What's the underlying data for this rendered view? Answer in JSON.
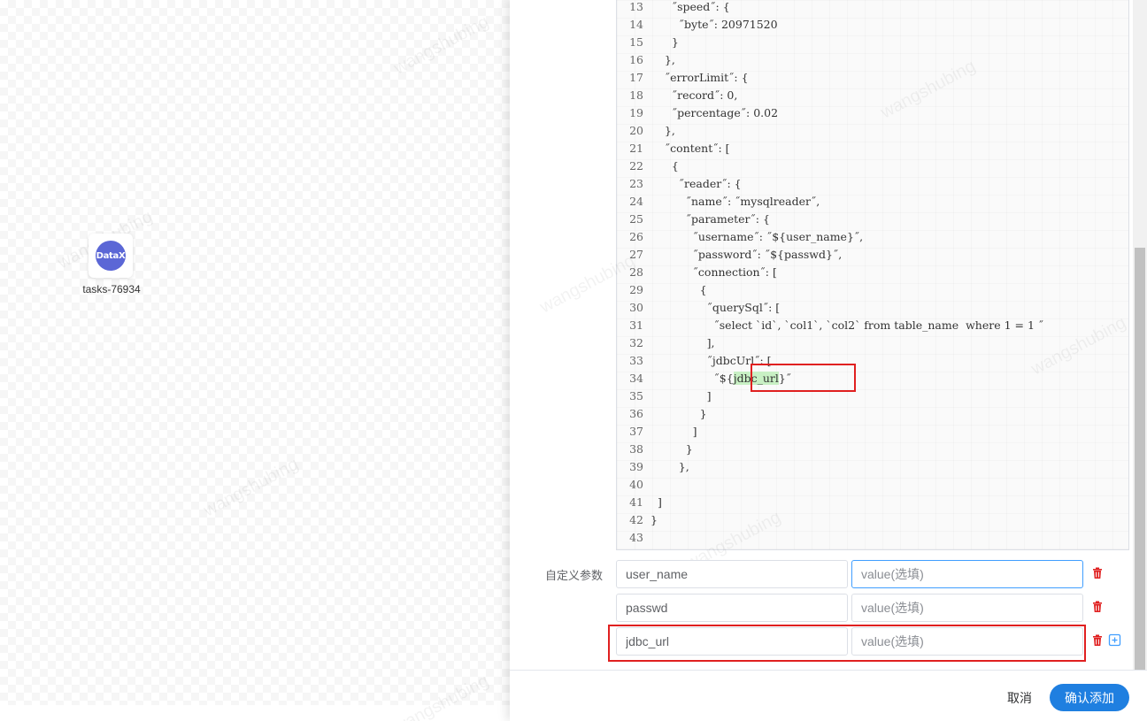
{
  "canvas": {
    "node": {
      "logo_text": "DataX",
      "label": "tasks-76934"
    },
    "watermark_text": "wangshubing"
  },
  "editor": {
    "lines": [
      {
        "num": "13",
        "text": "      ˝speed˝: {"
      },
      {
        "num": "14",
        "text": "        ˝byte˝: 20971520"
      },
      {
        "num": "15",
        "text": "      }"
      },
      {
        "num": "16",
        "text": "    },"
      },
      {
        "num": "17",
        "text": "    ˝errorLimit˝: {"
      },
      {
        "num": "18",
        "text": "      ˝record˝: 0,"
      },
      {
        "num": "19",
        "text": "      ˝percentage˝: 0.02"
      },
      {
        "num": "20",
        "text": "    },"
      },
      {
        "num": "21",
        "text": "    ˝content˝: ["
      },
      {
        "num": "22",
        "text": "      {"
      },
      {
        "num": "23",
        "text": "        ˝reader˝: {"
      },
      {
        "num": "24",
        "text": "          ˝name˝: ˝mysqlreader˝,"
      },
      {
        "num": "25",
        "text": "          ˝parameter˝: {"
      },
      {
        "num": "26",
        "text": "            ˝username˝: ˝${user_name}˝,"
      },
      {
        "num": "27",
        "text": "            ˝password˝: ˝${passwd}˝,"
      },
      {
        "num": "28",
        "text": "            ˝connection˝: ["
      },
      {
        "num": "29",
        "text": "              {"
      },
      {
        "num": "30",
        "text": "                ˝querySql˝: ["
      },
      {
        "num": "31",
        "text": "                  ˝select `id`, `col1`, `col2` from table_name  where 1 = 1 ˝"
      },
      {
        "num": "32",
        "text": "                ],"
      },
      {
        "num": "33",
        "text": "                ˝jdbcUrl˝: ["
      },
      {
        "num": "34",
        "pre": "                  ˝${",
        "highlight": "jdbc_url",
        "post": "}˝"
      },
      {
        "num": "35",
        "text": "                ]"
      },
      {
        "num": "36",
        "text": "              }"
      },
      {
        "num": "37",
        "text": "            ]"
      },
      {
        "num": "38",
        "text": "          }"
      },
      {
        "num": "39",
        "text": "        },"
      },
      {
        "num": "40",
        "text": ""
      },
      {
        "num": "41",
        "text": "  ]"
      },
      {
        "num": "42",
        "text": "}"
      },
      {
        "num": "43",
        "text": ""
      }
    ]
  },
  "params": {
    "label": "自定义参数",
    "rows": [
      {
        "key": "user_name",
        "value_placeholder": "value(选填)"
      },
      {
        "key": "passwd",
        "value_placeholder": "value(选填)"
      },
      {
        "key": "jdbc_url",
        "value_placeholder": "value(选填)"
      }
    ]
  },
  "footer": {
    "cancel_label": "取消",
    "confirm_label": "确认添加"
  },
  "colors": {
    "primary": "#1f7fe0",
    "delete_icon": "#e02020",
    "add_icon": "#409eff",
    "annotation_box": "#e02020",
    "highlight": "#c8f0c4"
  }
}
